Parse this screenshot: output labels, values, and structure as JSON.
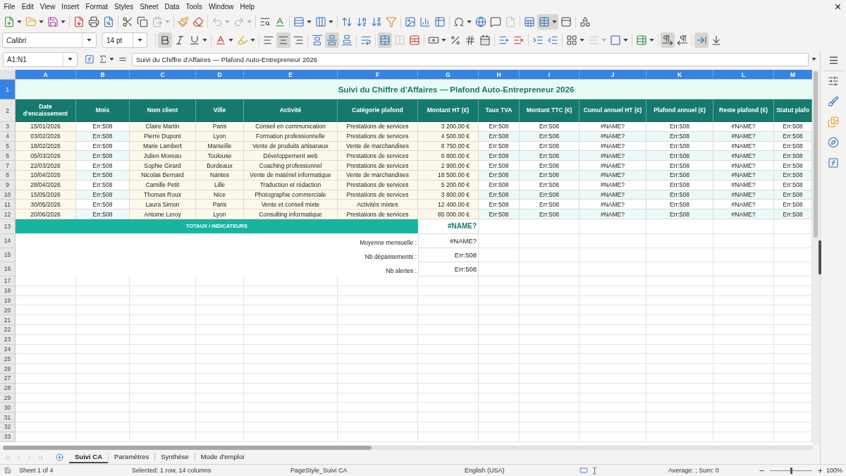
{
  "menu_bar": [
    "File",
    "Edit",
    "View",
    "Insert",
    "Format",
    "Styles",
    "Sheet",
    "Data",
    "Tools",
    "Window",
    "Help"
  ],
  "standard_toolbar": [
    [
      {
        "kind": "new",
        "dropdown": true,
        "on": false,
        "disabled": false
      },
      {
        "kind": "open",
        "dropdown": true,
        "on": false,
        "disabled": false
      },
      {
        "kind": "save",
        "dropdown": true,
        "on": false,
        "disabled": false
      }
    ],
    [
      {
        "kind": "export_pdf",
        "dropdown": false,
        "on": false,
        "disabled": false
      },
      {
        "kind": "print",
        "dropdown": false,
        "on": false,
        "disabled": false
      },
      {
        "kind": "print_preview",
        "dropdown": false,
        "on": false,
        "disabled": false
      }
    ],
    [
      {
        "kind": "cut",
        "dropdown": false,
        "on": false,
        "disabled": false
      },
      {
        "kind": "copy",
        "dropdown": false,
        "on": false,
        "disabled": false
      },
      {
        "kind": "paste",
        "dropdown": true,
        "on": false,
        "disabled": true
      }
    ],
    [
      {
        "kind": "clone_format",
        "dropdown": false,
        "on": false,
        "disabled": false
      },
      {
        "kind": "clear_format",
        "dropdown": false,
        "on": false,
        "disabled": false
      }
    ],
    [
      {
        "kind": "undo",
        "dropdown": true,
        "on": false,
        "disabled": true
      },
      {
        "kind": "redo",
        "dropdown": true,
        "on": false,
        "disabled": true
      }
    ],
    [
      {
        "kind": "find_replace",
        "dropdown": false,
        "on": false,
        "disabled": false
      },
      {
        "kind": "spelling",
        "dropdown": false,
        "on": false,
        "disabled": false
      }
    ],
    [
      {
        "kind": "row",
        "dropdown": true,
        "on": false,
        "disabled": false
      },
      {
        "kind": "column",
        "dropdown": true,
        "on": false,
        "disabled": false
      }
    ],
    [
      {
        "kind": "sort",
        "dropdown": false,
        "on": false,
        "disabled": false
      },
      {
        "kind": "sort_asc",
        "dropdown": false,
        "on": false,
        "disabled": false
      },
      {
        "kind": "sort_desc",
        "dropdown": false,
        "on": false,
        "disabled": false
      },
      {
        "kind": "autofilter",
        "dropdown": false,
        "on": false,
        "disabled": false
      }
    ],
    [
      {
        "kind": "image",
        "dropdown": false,
        "on": false,
        "disabled": false
      },
      {
        "kind": "chart",
        "dropdown": false,
        "on": false,
        "disabled": false
      },
      {
        "kind": "pivot",
        "dropdown": false,
        "on": false,
        "disabled": false
      }
    ],
    [
      {
        "kind": "special_char",
        "dropdown": true,
        "on": false,
        "disabled": false
      },
      {
        "kind": "hyperlink",
        "dropdown": false,
        "on": false,
        "disabled": false
      },
      {
        "kind": "comment",
        "dropdown": false,
        "on": false,
        "disabled": false
      },
      {
        "kind": "header_footer",
        "dropdown": false,
        "on": false,
        "disabled": true
      }
    ],
    [
      {
        "kind": "print_area",
        "dropdown": false,
        "on": false,
        "disabled": false
      },
      {
        "kind": "freeze",
        "dropdown": true,
        "on": true,
        "disabled": false
      },
      {
        "kind": "split",
        "dropdown": false,
        "on": false,
        "disabled": false
      }
    ],
    [
      {
        "kind": "shapes",
        "dropdown": false,
        "on": false,
        "disabled": false
      }
    ]
  ],
  "formatting_toolbar": {
    "font_name": "Calibri",
    "font_size": "14 pt",
    "tools": [
      [
        {
          "kind": "bold",
          "dropdown": false,
          "on": true,
          "disabled": false
        },
        {
          "kind": "italic",
          "dropdown": false,
          "on": false,
          "disabled": false
        },
        {
          "kind": "underline",
          "dropdown": true,
          "on": false,
          "disabled": false
        }
      ],
      [
        {
          "kind": "font_color",
          "dropdown": true,
          "on": false,
          "disabled": false
        },
        {
          "kind": "highlight",
          "dropdown": true,
          "on": false,
          "disabled": false
        }
      ],
      [
        {
          "kind": "align_left",
          "dropdown": false,
          "on": false,
          "disabled": false
        },
        {
          "kind": "align_center",
          "dropdown": false,
          "on": true,
          "disabled": false
        },
        {
          "kind": "align_right",
          "dropdown": false,
          "on": false,
          "disabled": false
        }
      ],
      [
        {
          "kind": "align_top",
          "dropdown": false,
          "on": false,
          "disabled": false
        },
        {
          "kind": "align_middle",
          "dropdown": false,
          "on": true,
          "disabled": false
        },
        {
          "kind": "align_bottom",
          "dropdown": false,
          "on": false,
          "disabled": false
        }
      ],
      [
        {
          "kind": "wrap",
          "dropdown": false,
          "on": false,
          "disabled": false
        }
      ],
      [
        {
          "kind": "merge_center",
          "dropdown": false,
          "on": true,
          "disabled": false
        },
        {
          "kind": "merge",
          "dropdown": false,
          "on": false,
          "disabled": true
        },
        {
          "kind": "unmerge",
          "dropdown": false,
          "on": false,
          "disabled": false
        }
      ],
      [
        {
          "kind": "currency",
          "dropdown": true,
          "on": false,
          "disabled": false
        },
        {
          "kind": "percent",
          "dropdown": false,
          "on": false,
          "disabled": false
        },
        {
          "kind": "standard",
          "dropdown": false,
          "on": false,
          "disabled": false
        },
        {
          "kind": "date",
          "dropdown": false,
          "on": false,
          "disabled": false
        }
      ],
      [
        {
          "kind": "add_decimal",
          "dropdown": false,
          "on": false,
          "disabled": false
        },
        {
          "kind": "delete_decimal",
          "dropdown": false,
          "on": false,
          "disabled": false
        }
      ],
      [
        {
          "kind": "indent",
          "dropdown": false,
          "on": false,
          "disabled": false
        },
        {
          "kind": "outdent",
          "dropdown": false,
          "on": false,
          "disabled": false
        }
      ],
      [
        {
          "kind": "borders",
          "dropdown": true,
          "on": false,
          "disabled": false
        },
        {
          "kind": "border_style",
          "dropdown": true,
          "on": false,
          "disabled": true
        },
        {
          "kind": "border_color",
          "dropdown": true,
          "on": false,
          "disabled": false
        }
      ],
      [
        {
          "kind": "conditional",
          "dropdown": true,
          "on": false,
          "disabled": false
        }
      ],
      [
        {
          "kind": "ltr",
          "dropdown": false,
          "on": true,
          "disabled": false
        },
        {
          "kind": "rtl",
          "dropdown": false,
          "on": false,
          "disabled": false
        }
      ],
      [
        {
          "kind": "text_direction",
          "dropdown": false,
          "on": true,
          "disabled": false
        },
        {
          "kind": "vertical_text",
          "dropdown": false,
          "on": false,
          "disabled": false
        }
      ]
    ]
  },
  "formula_bar": {
    "name_box": "A1:N1",
    "content": "Suivi du Chiffre d'Affaires — Plafond Auto-Entrepreneur 2026"
  },
  "sheet": {
    "column_headers": [
      {
        "label": "A",
        "selected": true
      },
      {
        "label": "B",
        "selected": true
      },
      {
        "label": "C",
        "selected": true
      },
      {
        "label": "D",
        "selected": true
      },
      {
        "label": "E",
        "selected": true
      },
      {
        "label": "F",
        "selected": true
      },
      {
        "label": "G",
        "selected": true
      },
      {
        "label": "H",
        "selected": true
      },
      {
        "label": "I",
        "selected": true
      },
      {
        "label": "J",
        "selected": true
      },
      {
        "label": "K",
        "selected": true
      },
      {
        "label": "L",
        "selected": true
      },
      {
        "label": "M",
        "selected": true
      }
    ],
    "row_headers": [
      {
        "label": "1",
        "selected": true
      },
      {
        "label": "2",
        "selected": false
      },
      {
        "label": "3",
        "selected": false
      },
      {
        "label": "4",
        "selected": false
      },
      {
        "label": "5",
        "selected": false
      },
      {
        "label": "6",
        "selected": false
      },
      {
        "label": "7",
        "selected": false
      },
      {
        "label": "8",
        "selected": false
      },
      {
        "label": "9",
        "selected": false
      },
      {
        "label": "10",
        "selected": false
      },
      {
        "label": "11",
        "selected": false
      },
      {
        "label": "12",
        "selected": false
      },
      {
        "label": "13",
        "selected": false
      },
      {
        "label": "14",
        "selected": false
      },
      {
        "label": "15",
        "selected": false
      },
      {
        "label": "16",
        "selected": false
      },
      {
        "label": "17",
        "selected": false
      },
      {
        "label": "18",
        "selected": false
      },
      {
        "label": "19",
        "selected": false
      },
      {
        "label": "20",
        "selected": false
      },
      {
        "label": "21",
        "selected": false
      },
      {
        "label": "22",
        "selected": false
      },
      {
        "label": "23",
        "selected": false
      },
      {
        "label": "24",
        "selected": false
      },
      {
        "label": "25",
        "selected": false
      },
      {
        "label": "26",
        "selected": false
      },
      {
        "label": "27",
        "selected": false
      },
      {
        "label": "28",
        "selected": false
      },
      {
        "label": "29",
        "selected": false
      },
      {
        "label": "30",
        "selected": false
      },
      {
        "label": "31",
        "selected": false
      },
      {
        "label": "32",
        "selected": false
      },
      {
        "label": "33",
        "selected": false
      }
    ],
    "title": "Suivi du Chiffre d'Affaires — Plafond Auto-Entrepreneur 2026",
    "table": {
      "columns": [
        {
          "label": "Date d'encaissement",
          "kind": "input"
        },
        {
          "label": "Mois",
          "kind": "formula"
        },
        {
          "label": "Nom client",
          "kind": "input"
        },
        {
          "label": "Ville",
          "kind": "input"
        },
        {
          "label": "Activité",
          "kind": "input"
        },
        {
          "label": "Catégorie plafond",
          "kind": "input"
        },
        {
          "label": "Montant HT (€)",
          "kind": "amount"
        },
        {
          "label": "Taux TVA",
          "kind": "formula"
        },
        {
          "label": "Montant TTC (€)",
          "kind": "formula"
        },
        {
          "label": "Cumul annuel HT (€)",
          "kind": "formula"
        },
        {
          "label": "Plafond annuel (€)",
          "kind": "formula"
        },
        {
          "label": "Reste plafond (€)",
          "kind": "formula"
        },
        {
          "label": "Statut plafo",
          "kind": "formula"
        }
      ],
      "rows": [
        [
          "15/01/2026",
          "Err:508",
          "Claire Martin",
          "Paris",
          "Conseil en communication",
          "Prestations de services",
          "3 200.00 €",
          "Err:508",
          "Err:508",
          "#NAME?",
          "Err:508",
          "#NAME?",
          "Err:508"
        ],
        [
          "03/02/2026",
          "Err:508",
          "Pierre Dupont",
          "Lyon",
          "Formation professionnelle",
          "Prestations de services",
          "4 500.00 €",
          "Err:508",
          "Err:508",
          "#NAME?",
          "Err:508",
          "#NAME?",
          "Err:508"
        ],
        [
          "18/02/2026",
          "Err:508",
          "Marie Lambert",
          "Marseille",
          "Vente de produits artisanaux",
          "Vente de marchandises",
          "8 750.00 €",
          "Err:508",
          "Err:508",
          "#NAME?",
          "Err:508",
          "#NAME?",
          "Err:508"
        ],
        [
          "05/03/2026",
          "Err:508",
          "Julien Moreau",
          "Toulouse",
          "Développement web",
          "Prestations de services",
          "6 800.00 €",
          "Err:508",
          "Err:508",
          "#NAME?",
          "Err:508",
          "#NAME?",
          "Err:508"
        ],
        [
          "22/03/2026",
          "Err:508",
          "Sophie Girard",
          "Bordeaux",
          "Coaching professionnel",
          "Prestations de services",
          "2 900.00 €",
          "Err:508",
          "Err:508",
          "#NAME?",
          "Err:508",
          "#NAME?",
          "Err:508"
        ],
        [
          "10/04/2026",
          "Err:508",
          "Nicolas Bernard",
          "Nantes",
          "Vente de matériel informatique",
          "Vente de marchandises",
          "18 500.00 €",
          "Err:508",
          "Err:508",
          "#NAME?",
          "Err:508",
          "#NAME?",
          "Err:508"
        ],
        [
          "28/04/2026",
          "Err:508",
          "Camille Petit",
          "Lille",
          "Traduction et rédaction",
          "Prestations de services",
          "5 200.00 €",
          "Err:508",
          "Err:508",
          "#NAME?",
          "Err:508",
          "#NAME?",
          "Err:508"
        ],
        [
          "15/05/2026",
          "Err:508",
          "Thomas Roux",
          "Nice",
          "Photographie commerciale",
          "Prestations de services",
          "3 800.00 €",
          "Err:508",
          "Err:508",
          "#NAME?",
          "Err:508",
          "#NAME?",
          "Err:508"
        ],
        [
          "30/05/2026",
          "Err:508",
          "Laura Simon",
          "Paris",
          "Vente et conseil mixte",
          "Activités mixtes",
          "12 400.00 €",
          "Err:508",
          "Err:508",
          "#NAME?",
          "Err:508",
          "#NAME?",
          "Err:508"
        ],
        [
          "20/06/2026",
          "Err:508",
          "Antoine Leroy",
          "Lyon",
          "Consulting informatique",
          "Prestations de services",
          "85 000.00 €",
          "Err:508",
          "Err:508",
          "#NAME?",
          "Err:508",
          "#NAME?",
          "Err:508"
        ]
      ]
    },
    "totals": {
      "heading": "TOTAUX / INDICATEURS",
      "value": "#NAME?",
      "indicators": [
        {
          "label": "Moyenne mensuelle :",
          "value": "#NAME?"
        },
        {
          "label": "Nb dépassements :",
          "value": "Err:508"
        },
        {
          "label": "Nb alertes :",
          "value": "Err:508"
        }
      ]
    }
  },
  "sheet_navigation": [
    {
      "kind": "first",
      "disabled": true
    },
    {
      "kind": "previous",
      "disabled": true
    },
    {
      "kind": "next",
      "disabled": true
    },
    {
      "kind": "last",
      "disabled": true
    }
  ],
  "sheet_tabs": [
    {
      "label": "Suivi CA",
      "selected": true
    },
    {
      "label": "Paramètres",
      "selected": false
    },
    {
      "label": "Synthèse",
      "selected": false
    },
    {
      "label": "Mode d'emploi",
      "selected": false
    }
  ],
  "status_bar": {
    "sheet": "Sheet 1 of 4",
    "selection": "Selected: 1 row, 14 columns",
    "page_style": "PageStyle_Suivi CA",
    "language": "English (USA)",
    "summary": "Average: ; Sum: 0",
    "zoom": {
      "level": 0.5,
      "reading": "100%"
    }
  }
}
